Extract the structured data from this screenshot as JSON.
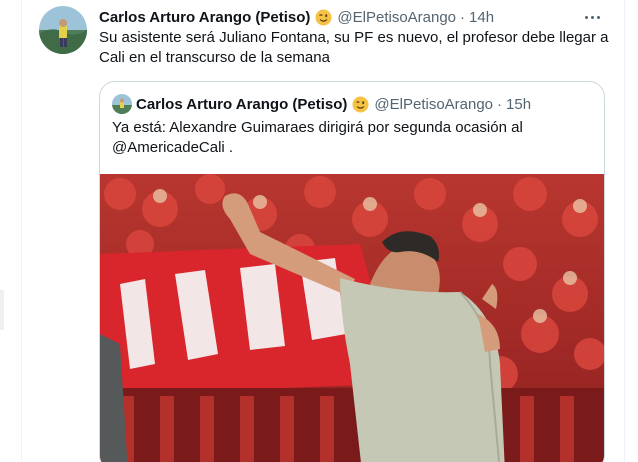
{
  "tweet": {
    "author_name": "Carlos Arturo Arango (Petiso)",
    "author_emoji": "winking-face-emoji",
    "handle": "@ElPetisoArango",
    "separator": "·",
    "time": "14h",
    "text": "Su asistente será Juliano Fontana, su PF es nuevo, el profesor debe llegar a Cali en el transcurso de la semana"
  },
  "quoted_tweet": {
    "author_name": "Carlos Arturo Arango (Petiso)",
    "author_emoji": "winking-face-emoji",
    "handle": "@ElPetisoArango",
    "separator": "·",
    "time": "15h",
    "text": "Ya está: Alexandre Guimaraes dirigirá por segunda ocasión al @AmericadeCali ."
  },
  "colors": {
    "text_primary": "#0f1419",
    "text_secondary": "#536471",
    "border": "#cfd9de",
    "photo_red": "#d8262c"
  },
  "icons": [
    "more-options-icon",
    "winking-face-emoji"
  ]
}
